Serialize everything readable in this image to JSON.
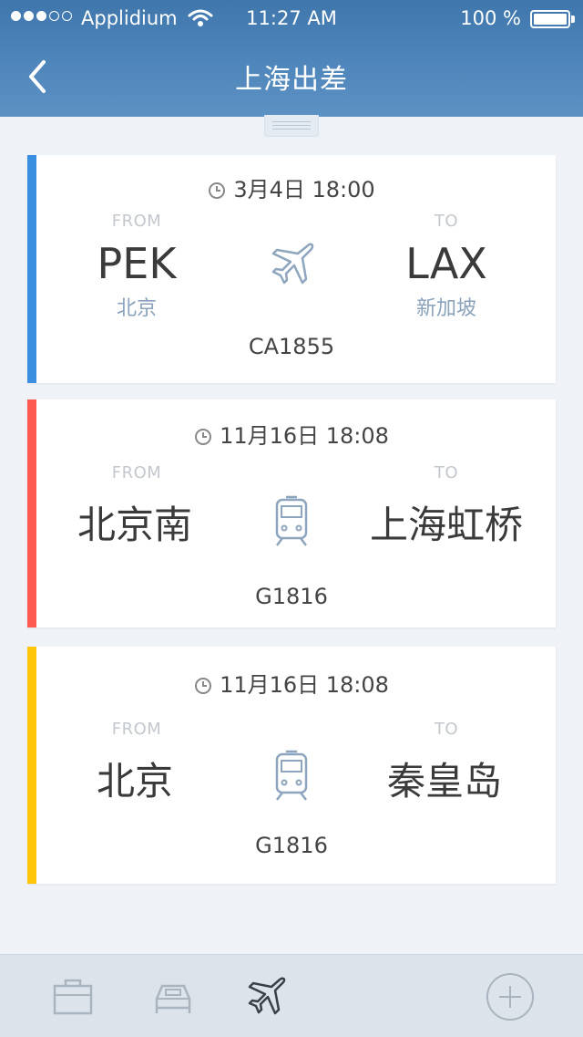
{
  "status": {
    "carrier": "Applidium",
    "time": "11:27 AM",
    "battery": "100 %"
  },
  "nav": {
    "title": "上海出差"
  },
  "trips": [
    {
      "accent": "#3b8fe0",
      "mode": "plane-icon",
      "date": "3月4日  18:00",
      "from_label": "FROM",
      "to_label": "TO",
      "from": "PEK",
      "from_city": "北京",
      "to": "LAX",
      "to_city": "新加坡",
      "number": "CA1855"
    },
    {
      "accent": "#ff5a4f",
      "mode": "train-icon",
      "date": "11月16日  18:08",
      "from_label": "FROM",
      "to_label": "TO",
      "from": "北京南",
      "to": "上海虹桥",
      "number": "G1816"
    },
    {
      "accent": "#ffc60a",
      "mode": "train-icon",
      "date": "11月16日  18:08",
      "from_label": "FROM",
      "to_label": "TO",
      "from": "北京",
      "to": "秦皇岛",
      "number": "G1816"
    }
  ],
  "tabs": [
    "briefcase-icon",
    "bed-icon",
    "plane-icon",
    "plus-icon"
  ]
}
